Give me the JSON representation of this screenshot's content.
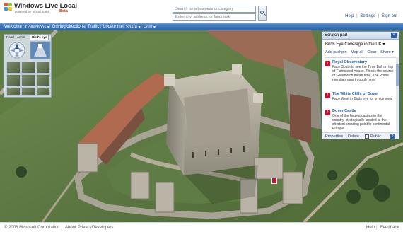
{
  "brand": {
    "title": "Windows Live Local",
    "subtitle": "powered by Virtual Earth",
    "badge": "Beta"
  },
  "search": {
    "business_placeholder": "Search for a business or category",
    "location_placeholder": "Enter city, address, or landmark"
  },
  "top_links": {
    "help": "Help",
    "settings": "Settings",
    "signout": "Sign out"
  },
  "nav": {
    "items": [
      "Welcome",
      "Collections ▾",
      "Driving directions",
      "Traffic",
      "Locate me",
      "Share ▾",
      "Print ▾"
    ]
  },
  "dashboard": {
    "tabs": [
      "Road",
      "Aerial",
      "Bird's eye"
    ]
  },
  "scratch_pad": {
    "title": "Scratch pad",
    "collection": "Birds Eye Coverage in the UK ▾",
    "actions": [
      "Add pushpin",
      "Map all",
      "Clear",
      "Share ▾"
    ],
    "items": [
      {
        "title": "Royal Observatory",
        "desc": "Face South to see the Time Ball on top of Flamsteed House. This is the source of Greenwich mean time. The Prime meridian runs through here!"
      },
      {
        "title": "The White Cliffs of Dover",
        "desc": "Face West in Birds eye for a nice view"
      },
      {
        "title": "Dover Castle",
        "desc": "One of the largest castles in the country, strategically located at the shortest crossing point to continental Europe."
      }
    ],
    "footer": {
      "properties": "Properties",
      "delete": "Delete",
      "public": "Public",
      "help": "?"
    }
  },
  "footer": {
    "copyright": "© 2006 Microsoft Corporation",
    "about": "About",
    "privacy": "Privacy",
    "developers": "Developers",
    "help": "Help",
    "feedback": "Feedback"
  },
  "colors": {
    "nav": "#2b62a8",
    "link": "#1e5ba8",
    "pin": "#c8102e"
  }
}
